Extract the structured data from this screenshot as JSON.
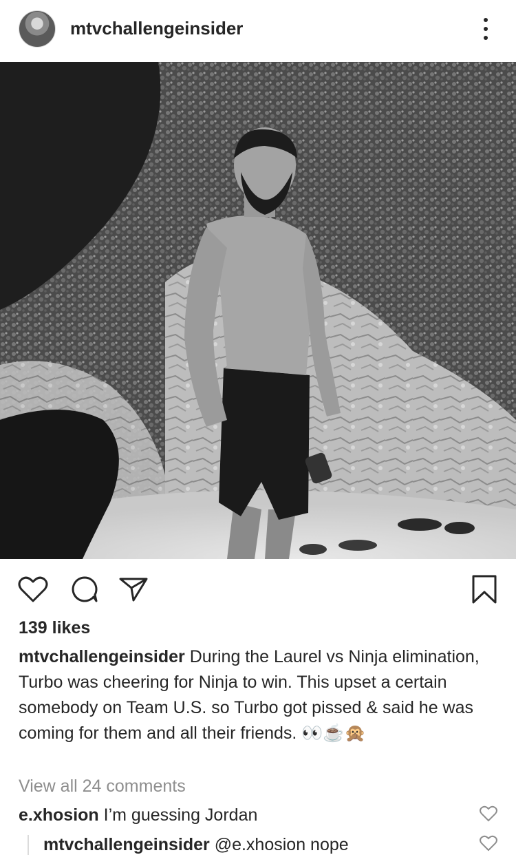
{
  "header": {
    "username": "mtvchallengeinsider"
  },
  "post": {
    "likes": "139 likes",
    "caption_username": "mtvchallengeinsider",
    "caption_text": "During the Laurel vs Ninja elimination, Turbo was cheering for Ninja to win. This upset a certain somebody on Team U.S. so Turbo got pissed & said he was coming for them and all their friends. 👀☕🙊",
    "view_all": "View all 24 comments"
  },
  "comments": [
    {
      "username": "e.xhosion",
      "text": "I’m guessing Jordan"
    },
    {
      "username": "mtvchallengeinsider",
      "text": "@e.xhosion nope"
    }
  ],
  "icons": {
    "like": "heart-outline-icon",
    "comment": "speech-bubble-icon",
    "share": "paper-plane-icon",
    "save": "bookmark-icon",
    "more": "vertical-dots-icon"
  }
}
